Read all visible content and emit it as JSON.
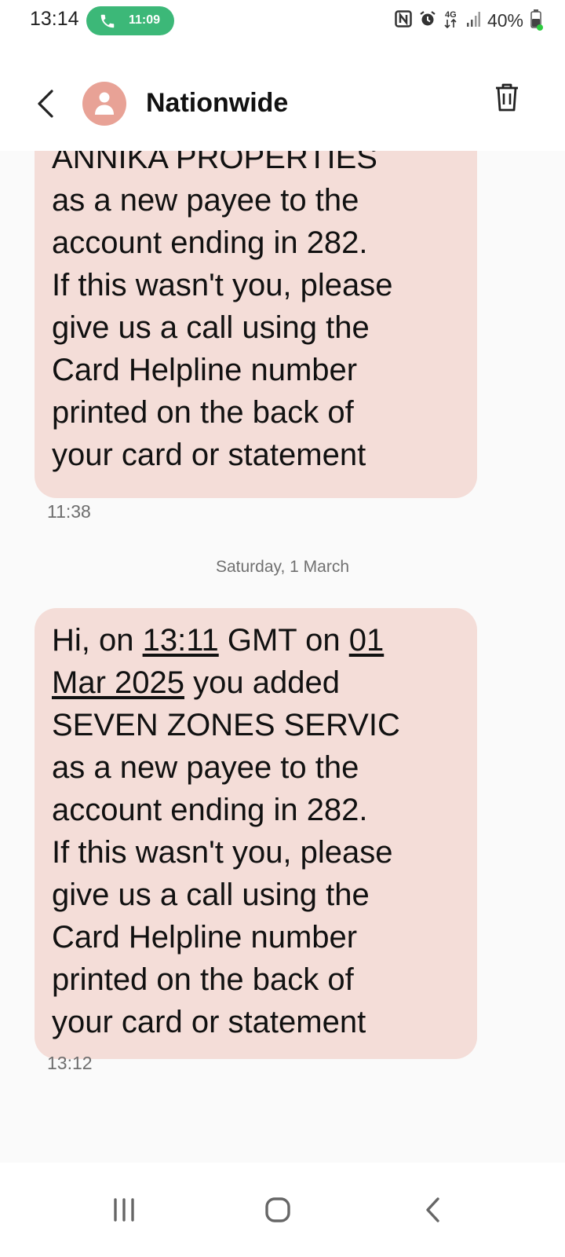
{
  "status_bar": {
    "time": "13:14",
    "call_time": "11:09",
    "battery_percent": "40%",
    "network_label": "4G",
    "icons": [
      "nfc-icon",
      "alarm-icon",
      "data-4g-icon",
      "signal-icon",
      "battery-icon"
    ]
  },
  "header": {
    "contact_name": "Nationwide",
    "icons": [
      "back-arrow-icon",
      "person-icon",
      "trash-icon"
    ]
  },
  "messages": [
    {
      "lines_plain": [
        "ANNIKA PROPERTIES",
        "as a new payee to the",
        "account ending in 282.",
        "If this wasn't you, please",
        "give us a call using the",
        "Card Helpline number",
        "printed on the back of",
        "your card or statement"
      ],
      "time": "11:38"
    },
    {
      "line1": {
        "a": "Hi, on ",
        "b": "13:11",
        "c": " GMT on ",
        "d": "01"
      },
      "line2": {
        "a": "Mar 2025",
        "b": " you added"
      },
      "lines_plain": [
        "SEVEN ZONES SERVIC",
        "as a new payee to the",
        "account ending in 282.",
        "If this wasn't you, please",
        "give us a call using the",
        "Card Helpline number",
        "printed on the back of",
        "your card or statement"
      ],
      "time": "13:12"
    }
  ],
  "date_separator": "Saturday, 1 March",
  "colors": {
    "bubble": "#f4ddd8",
    "call_pill": "#3cb878",
    "avatar": "#e8a296",
    "background": "#fafafa"
  },
  "nav": {
    "icons": [
      "recent-apps-icon",
      "home-icon",
      "back-icon"
    ]
  }
}
